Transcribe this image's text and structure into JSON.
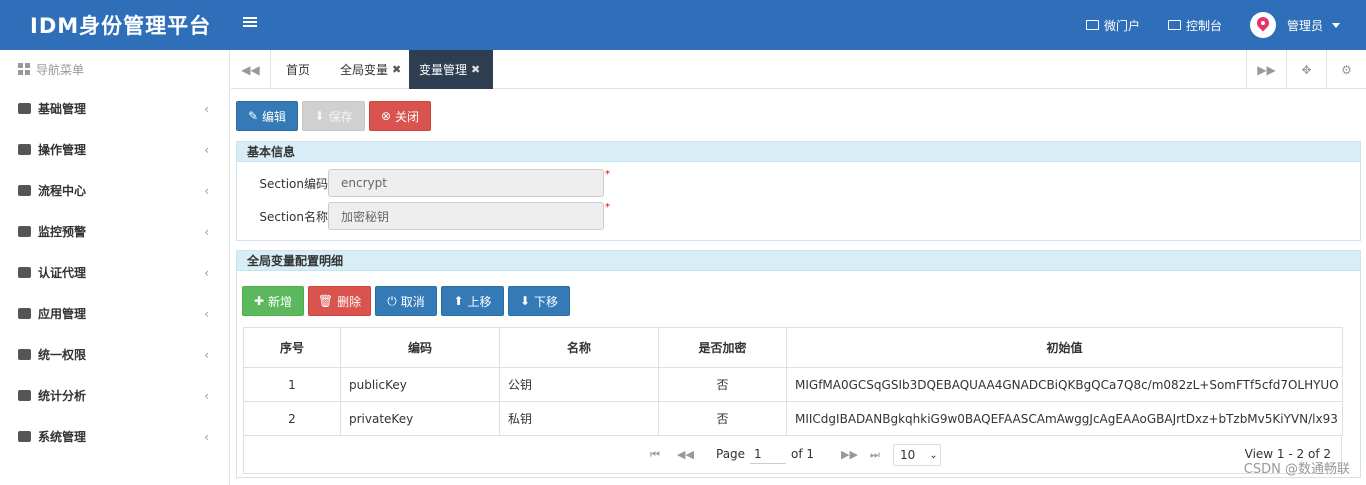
{
  "header": {
    "brand": "IDM身份管理平台",
    "micro_portal": "微门户",
    "console": "控制台",
    "user": "管理员"
  },
  "sidebar": {
    "title": "导航菜单",
    "items": [
      {
        "label": "基础管理",
        "icon": "id-card-icon"
      },
      {
        "label": "操作管理",
        "icon": "book-icon"
      },
      {
        "label": "流程中心",
        "icon": "shuffle-icon"
      },
      {
        "label": "监控预警",
        "icon": "eye-icon"
      },
      {
        "label": "认证代理",
        "icon": "users-icon"
      },
      {
        "label": "应用管理",
        "icon": "list-icon"
      },
      {
        "label": "统一权限",
        "icon": "sitemap-icon"
      },
      {
        "label": "统计分析",
        "icon": "area-chart-icon"
      },
      {
        "label": "系统管理",
        "icon": "gears-icon"
      }
    ]
  },
  "tabs": {
    "home": "首页",
    "global_vars": "全局变量",
    "var_mgmt": "变量管理"
  },
  "toolbar": {
    "edit": "编辑",
    "save": "保存",
    "close": "关闭"
  },
  "basic": {
    "title": "基本信息",
    "code_label": "Section编码",
    "code_value": "encrypt",
    "name_label": "Section名称",
    "name_value": "加密秘钥"
  },
  "detail": {
    "title": "全局变量配置明细",
    "add": "新增",
    "delete": "删除",
    "cancel": "取消",
    "up": "上移",
    "down": "下移",
    "columns": [
      "序号",
      "编码",
      "名称",
      "是否加密",
      "初始值"
    ],
    "rows": [
      [
        "1",
        "publicKey",
        "公钥",
        "否",
        "MIGfMA0GCSqGSIb3DQEBAQUAA4GNADCBiQKBgQCa7Q8c/m082zL+SomFTf5cfd7OLHYUO"
      ],
      [
        "2",
        "privateKey",
        "私钥",
        "否",
        "MIICdgIBADANBgkqhkiG9w0BAQEFAASCAmAwggJcAgEAAoGBAJrtDxz+bTzbMv5KiYVN/lx93"
      ]
    ],
    "pager": {
      "page_label": "Page",
      "page_value": "1",
      "of_label": "of 1",
      "page_size": "10",
      "view": "View 1 - 2 of 2"
    }
  },
  "watermark": "CSDN @数通畅联"
}
